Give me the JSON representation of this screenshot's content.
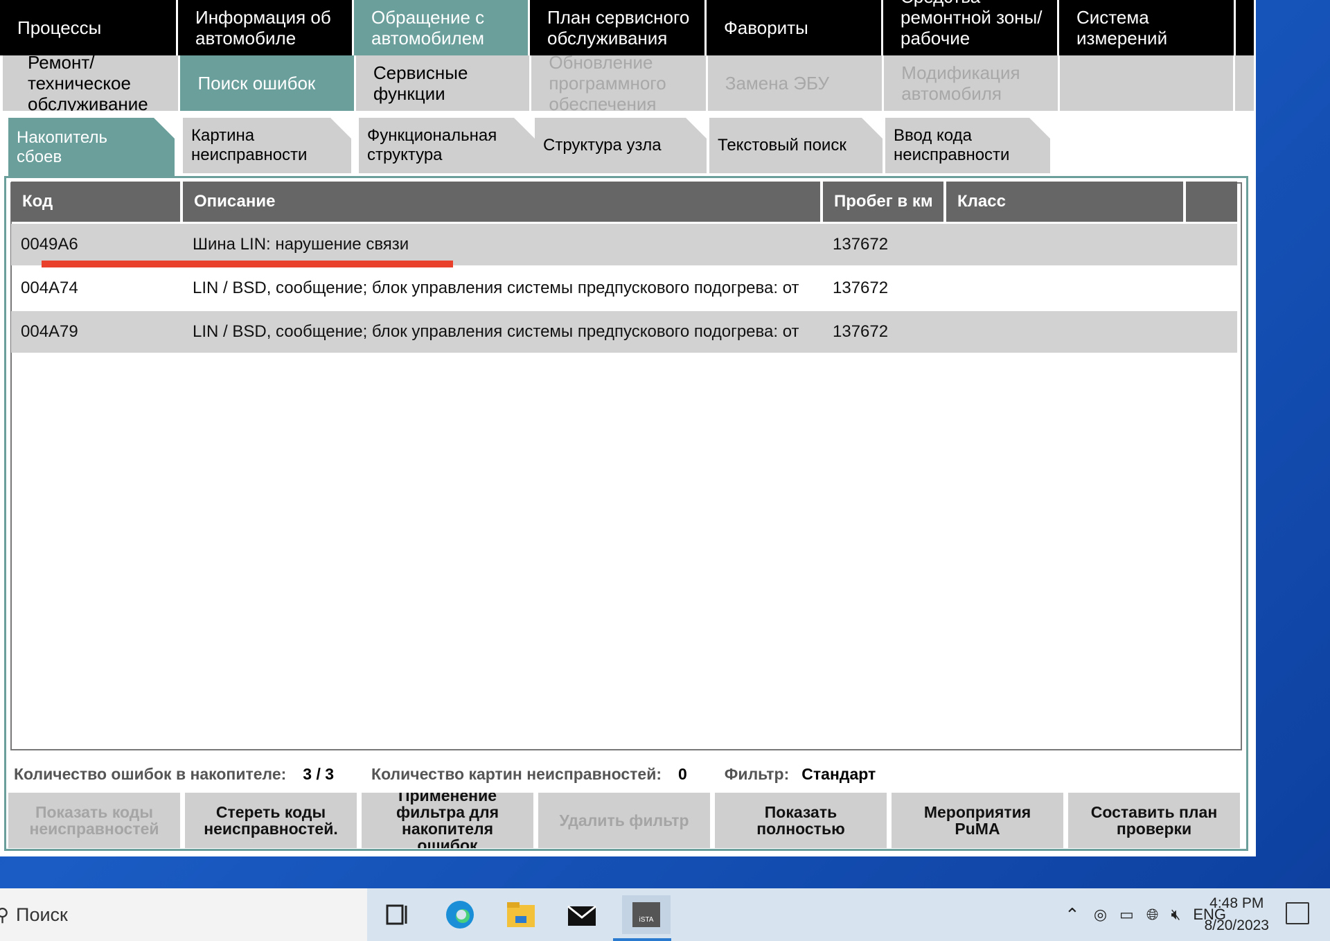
{
  "topnav": [
    {
      "label": "Процессы",
      "active": false
    },
    {
      "label": "Информация об\nавтомобиле",
      "active": false
    },
    {
      "label": "Обращение с\nавтомобилем",
      "active": true
    },
    {
      "label": "План сервисного\nобслуживания",
      "active": false
    },
    {
      "label": "Фавориты",
      "active": false
    },
    {
      "label": "Средства\nремонтной зоны/\nрабочие жидкости",
      "active": false
    },
    {
      "label": "Система\nизмерений",
      "active": false
    }
  ],
  "subnav": [
    {
      "label": "Ремонт/\nтехническое\nобслуживание"
    },
    {
      "label": "Поиск ошибок"
    },
    {
      "label": "Сервисные\nфункции"
    },
    {
      "label": "Обновление\nпрограммного\nобеспечения"
    },
    {
      "label": "Замена ЭБУ"
    },
    {
      "label": "Модификация\nавтомобиля"
    }
  ],
  "tabs": [
    {
      "label": "Накопитель\nсбоев"
    },
    {
      "label": "Картина\nнеисправности"
    },
    {
      "label": "Функциональная\nструктура"
    },
    {
      "label": "Структура узла"
    },
    {
      "label": "Текстовый поиск"
    },
    {
      "label": "Ввод кода\nнеисправности"
    }
  ],
  "table": {
    "headers": [
      "Код",
      "Описание",
      "Пробег в км",
      "Класс",
      ""
    ],
    "rows": [
      [
        "0049A6",
        "Шина LIN: нарушение связи",
        "137672",
        ""
      ],
      [
        "004A74",
        "LIN / BSD, сообщение; блок управления системы предпускового подогрева: от",
        "137672",
        ""
      ],
      [
        "004A79",
        "LIN / BSD, сообщение; блок управления системы предпускового подогрева: от",
        "137672",
        ""
      ]
    ]
  },
  "stats": {
    "errors_label": "Количество ошибок в накопителе:",
    "errors_value": "3 / 3",
    "pictures_label": "Количество картин неисправностей:",
    "pictures_value": "0",
    "filter_label": "Фильтр:",
    "filter_value": "Стандарт"
  },
  "buttons": [
    {
      "label": "Показать коды\nнеисправностей",
      "enabled": false
    },
    {
      "label": "Стереть коды\nнеисправностей.",
      "enabled": true
    },
    {
      "label": "Применение\nфильтра для\nнакопителя\nошибок",
      "enabled": true
    },
    {
      "label": "Удалить фильтр",
      "enabled": false
    },
    {
      "label": "Показать\nполностью",
      "enabled": true
    },
    {
      "label": "Мероприятия\nPuMA",
      "enabled": true
    },
    {
      "label": "Составить план\nпроверки",
      "enabled": true
    }
  ],
  "taskbar": {
    "search_placeholder": "Поиск",
    "language": "ENG",
    "time": "4:48 PM",
    "date": "8/20/2023",
    "apps": [
      "task-view-icon",
      "edge-icon",
      "file-explorer-icon",
      "mail-icon",
      "ista-app-icon"
    ]
  },
  "colors": {
    "accent": "#6a9f9c",
    "underline": "#e8402a",
    "menu_bg": "#000000"
  }
}
